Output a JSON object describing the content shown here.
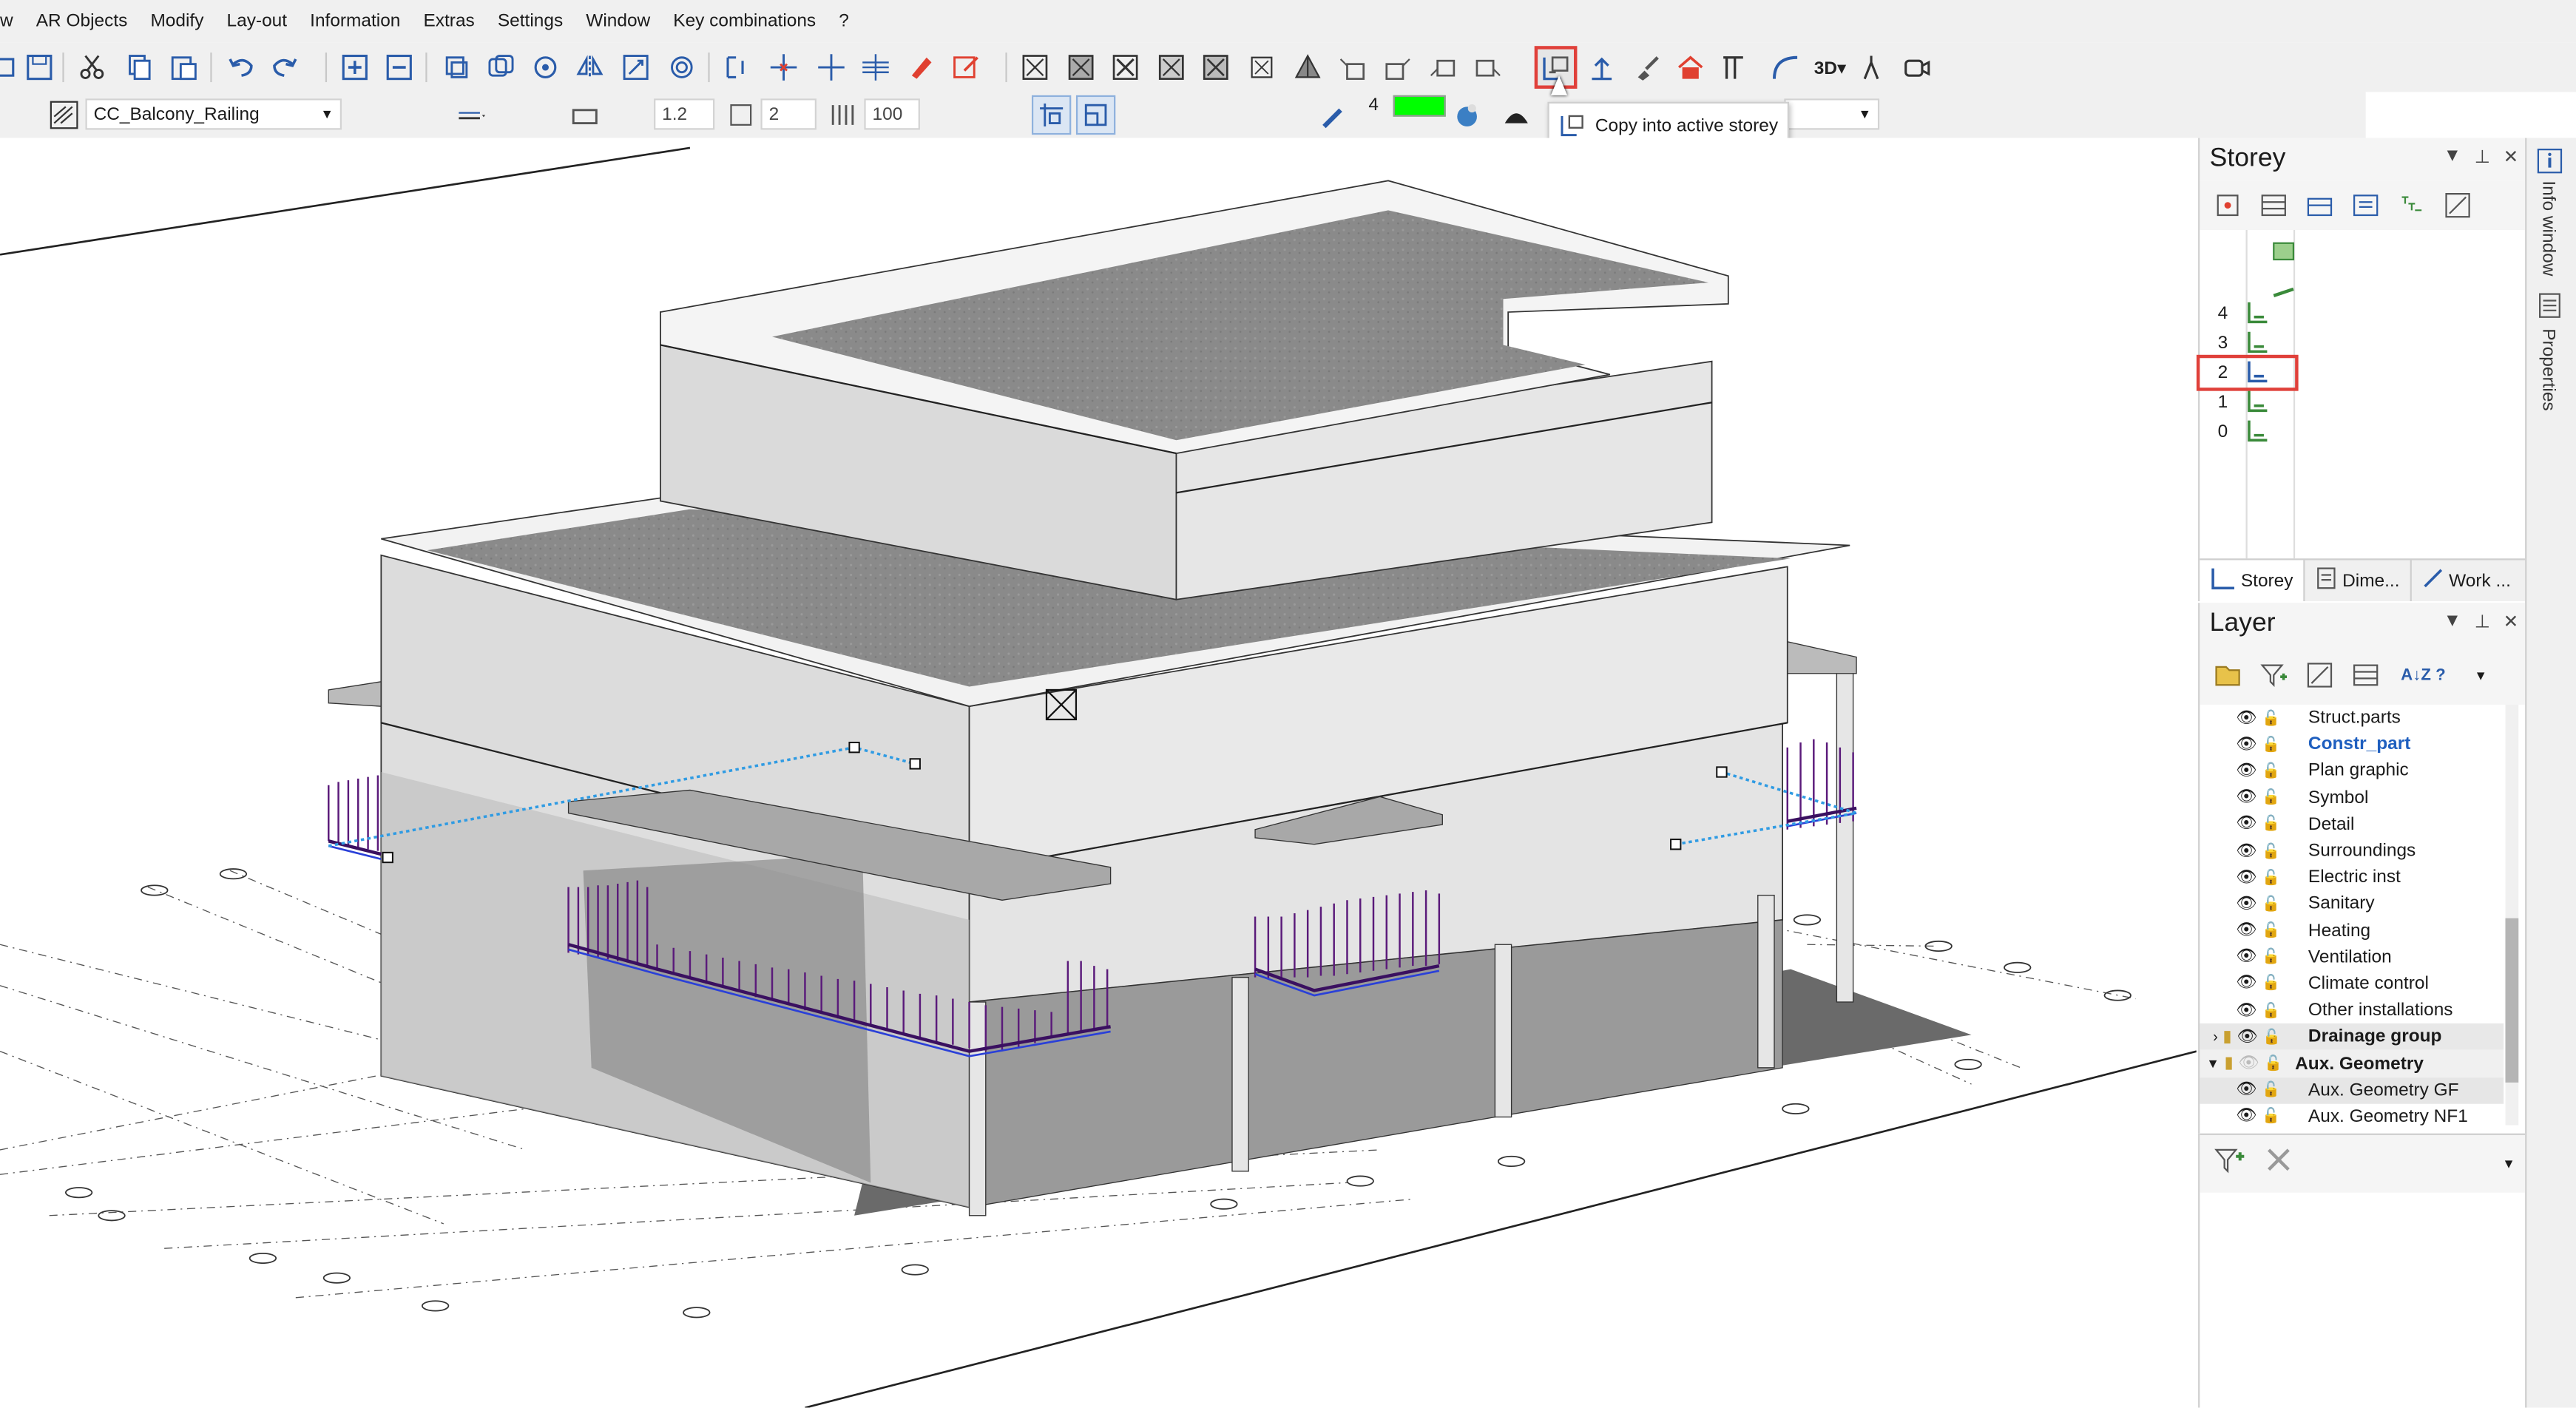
{
  "menu": {
    "items": [
      "w",
      "AR Objects",
      "Modify",
      "Lay-out",
      "Information",
      "Extras",
      "Settings",
      "Window",
      "Key combinations",
      "?"
    ]
  },
  "toolbar2": {
    "style_combo": "CC_Balcony_Railing",
    "field_1": "1.2",
    "field_2": "2",
    "field_3": "100",
    "pen_number": "4",
    "color_swatch": "#00ff00"
  },
  "tooltip": {
    "text": "Copy into active storey"
  },
  "storey_panel": {
    "title": "Storey",
    "rows": [
      "4",
      "3",
      "2",
      "1",
      "0"
    ],
    "active": "2",
    "tabs": [
      "Storey",
      "Dime...",
      "Work ..."
    ]
  },
  "layer_panel": {
    "title": "Layer",
    "items": [
      {
        "label": "Struct.parts",
        "style": "normal"
      },
      {
        "label": "Constr_part",
        "style": "active"
      },
      {
        "label": "Plan graphic",
        "style": "normal"
      },
      {
        "label": "Symbol",
        "style": "normal"
      },
      {
        "label": "Detail",
        "style": "normal"
      },
      {
        "label": "Surroundings",
        "style": "normal"
      },
      {
        "label": "Electric inst",
        "style": "normal"
      },
      {
        "label": "Sanitary",
        "style": "normal"
      },
      {
        "label": "Heating",
        "style": "normal"
      },
      {
        "label": "Ventilation",
        "style": "normal"
      },
      {
        "label": "Climate control",
        "style": "normal"
      },
      {
        "label": "Other installations",
        "style": "normal"
      },
      {
        "label": "Drainage group",
        "style": "group"
      },
      {
        "label": "Aux. Geometry",
        "style": "group-open"
      },
      {
        "label": "Aux. Geometry GF",
        "style": "selected"
      },
      {
        "label": "Aux. Geometry NF1",
        "style": "normal"
      }
    ]
  },
  "side_strip": {
    "tabs": [
      "Info window",
      "Properties"
    ]
  },
  "colors": {
    "railing": "#5a1a7a",
    "highlight": "#e0403a",
    "active_layer": "#1f5fbf",
    "aux_line": "#2f9be3"
  }
}
